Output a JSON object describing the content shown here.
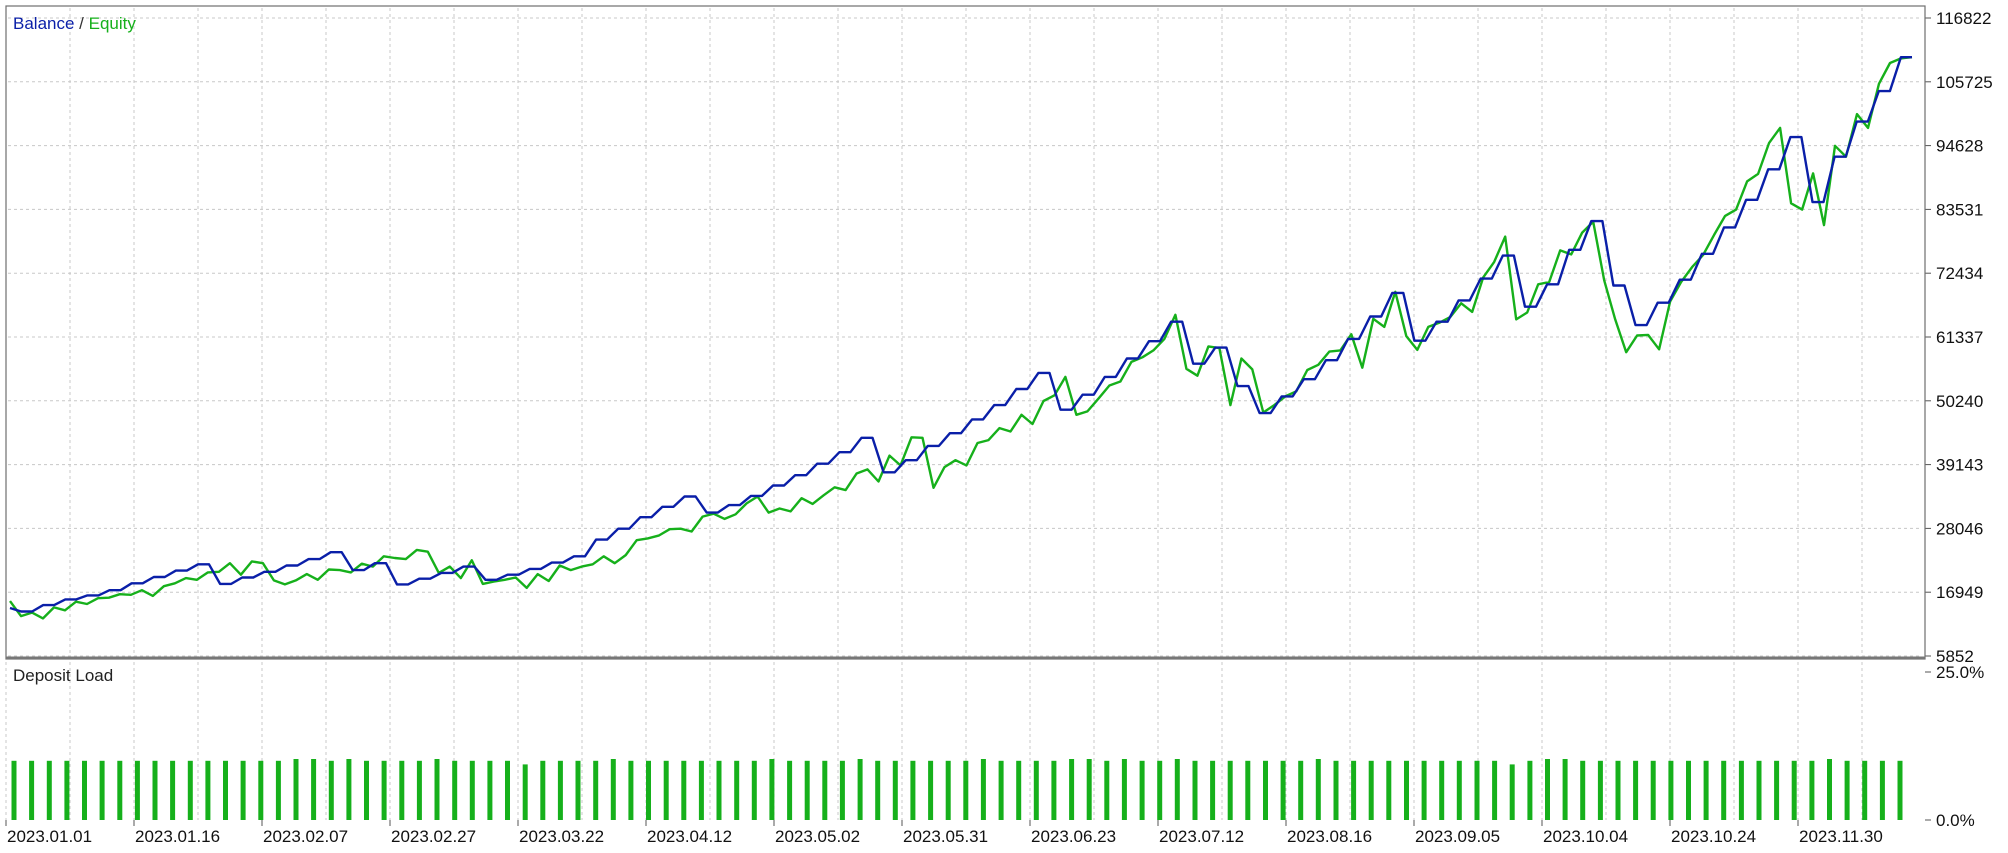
{
  "chart_data": [
    {
      "type": "line",
      "panel": "main",
      "legend": {
        "balance_label": "Balance",
        "separator": " / ",
        "equity_label": "Equity",
        "placement": "top-left"
      },
      "ylim": [
        5852,
        116822
      ],
      "y_ticks": [
        "116822",
        "105725",
        "94628",
        "83531",
        "72434",
        "61337",
        "50240",
        "39143",
        "28046",
        "16949",
        "5852"
      ],
      "grid": true,
      "colors": {
        "balance": "#0a1fa8",
        "equity": "#16b01b",
        "grid": "#c8c8c8",
        "axis": "#555555"
      },
      "series": [
        {
          "name": "Balance",
          "values": [
            14200,
            13600,
            13600,
            14700,
            14700,
            15700,
            15700,
            16400,
            16400,
            17300,
            17300,
            18500,
            18500,
            19600,
            19600,
            20700,
            20700,
            21800,
            21800,
            18400,
            18400,
            19500,
            19500,
            20500,
            20500,
            21600,
            21600,
            22700,
            22700,
            23900,
            23900,
            20800,
            20800,
            22000,
            22000,
            18300,
            18300,
            19300,
            19300,
            20300,
            20300,
            21400,
            21400,
            19100,
            19100,
            20000,
            20000,
            21000,
            21000,
            22100,
            22100,
            23200,
            23200,
            26100,
            26100,
            28000,
            28000,
            30000,
            30000,
            31800,
            31800,
            33600,
            33600,
            30800,
            30800,
            32100,
            32100,
            33700,
            33700,
            35500,
            35500,
            37300,
            37300,
            39300,
            39300,
            41300,
            41300,
            43800,
            43800,
            37800,
            37800,
            39900,
            39900,
            42400,
            42400,
            44600,
            44600,
            47000,
            47000,
            49500,
            49500,
            52300,
            52300,
            55100,
            55100,
            48700,
            48700,
            51300,
            51300,
            54400,
            54400,
            57600,
            57600,
            60600,
            60600,
            64000,
            64000,
            56700,
            56700,
            59500,
            59500,
            52800,
            52800,
            48100,
            48100,
            51000,
            51000,
            54000,
            54000,
            57300,
            57300,
            61000,
            61000,
            64900,
            64900,
            69000,
            69000,
            60700,
            60700,
            64000,
            64000,
            67700,
            67700,
            71500,
            71500,
            75500,
            75500,
            66600,
            66600,
            70500,
            70500,
            76500,
            76500,
            81500,
            81500,
            70300,
            70300,
            63400,
            63400,
            67300,
            67300,
            71300,
            71300,
            75800,
            75800,
            80400,
            80400,
            85200,
            85200,
            90500,
            90500,
            96100,
            96100,
            84800,
            84800,
            92700,
            92700,
            98800,
            98800,
            104100,
            104100,
            110000,
            110000
          ]
        },
        {
          "name": "Equity",
          "values": [
            15400,
            12800,
            13400,
            12400,
            14300,
            13800,
            15300,
            14900,
            15900,
            16000,
            16600,
            16500,
            17300,
            16300,
            18000,
            18500,
            19400,
            19100,
            20400,
            20500,
            22000,
            20000,
            22300,
            22000,
            19000,
            18300,
            19000,
            20100,
            19100,
            20900,
            20800,
            20400,
            21900,
            21400,
            23200,
            22900,
            22700,
            24300,
            24000,
            20300,
            21400,
            19400,
            22500,
            18400,
            18800,
            19100,
            19500,
            17700,
            20100,
            18900,
            21600,
            20800,
            21400,
            21800,
            23200,
            22000,
            23400,
            26000,
            26300,
            26800,
            27900,
            28000,
            27500,
            30100,
            30600,
            29700,
            30500,
            32400,
            33600,
            30800,
            31500,
            31000,
            33300,
            32300,
            33800,
            35200,
            34700,
            37600,
            38300,
            36200,
            40700,
            39000,
            43900,
            43800,
            35100,
            38700,
            39900,
            39000,
            42900,
            43400,
            45500,
            44900,
            47800,
            46200,
            50200,
            51200,
            54400,
            47800,
            48400,
            50600,
            52900,
            53600,
            57000,
            57800,
            59000,
            61000,
            65200,
            55800,
            54600,
            59700,
            59400,
            49500,
            57600,
            55700,
            48200,
            49500,
            51000,
            51900,
            55600,
            56500,
            58800,
            59000,
            61800,
            56000,
            64500,
            63100,
            69200,
            61500,
            59100,
            63100,
            63800,
            64800,
            67200,
            65700,
            71700,
            74400,
            78800,
            64400,
            65600,
            70500,
            70900,
            76400,
            75700,
            79500,
            81400,
            71200,
            64400,
            58700,
            61600,
            61700,
            59200,
            67500,
            70900,
            73500,
            75600,
            79100,
            82400,
            83500,
            88400,
            89700,
            95100,
            97700,
            84600,
            83500,
            89800,
            80800,
            94600,
            92700,
            100100,
            97700,
            105400,
            109000,
            109800,
            110000
          ]
        }
      ]
    },
    {
      "type": "bar",
      "panel": "deposit-load",
      "title": "Deposit Load",
      "ylim": [
        0,
        25
      ],
      "y_ticks": [
        "25.0%",
        "0.0%"
      ],
      "x_ticks": [
        "2023.01.01",
        "2023.01.16",
        "2023.02.07",
        "2023.02.27",
        "2023.03.22",
        "2023.04.12",
        "2023.05.02",
        "2023.05.31",
        "2023.06.23",
        "2023.07.12",
        "2023.08.16",
        "2023.09.05",
        "2023.10.04",
        "2023.10.24",
        "2023.11.30"
      ],
      "colors": {
        "bar": "#16b01b"
      },
      "values": [
        10.0,
        10.0,
        10.0,
        10.0,
        10.0,
        10.0,
        10.0,
        10.0,
        10.0,
        10.0,
        10.0,
        10.0,
        10.0,
        10.0,
        10.0,
        10.0,
        10.3,
        10.3,
        10.0,
        10.3,
        10.0,
        10.0,
        10.0,
        10.0,
        10.3,
        10.0,
        10.0,
        10.0,
        10.0,
        9.4,
        10.0,
        10.0,
        10.0,
        10.0,
        10.3,
        10.0,
        10.0,
        10.0,
        10.0,
        10.0,
        10.0,
        10.0,
        10.0,
        10.3,
        10.0,
        10.0,
        10.0,
        10.0,
        10.3,
        10.0,
        10.0,
        10.0,
        10.0,
        10.0,
        10.0,
        10.3,
        10.0,
        10.0,
        10.0,
        10.0,
        10.3,
        10.3,
        10.0,
        10.3,
        10.0,
        10.0,
        10.3,
        10.0,
        10.0,
        10.0,
        10.0,
        10.0,
        10.0,
        10.0,
        10.3,
        10.0,
        10.0,
        10.0,
        10.0,
        10.0,
        10.0,
        10.0,
        10.0,
        10.0,
        10.0,
        9.4,
        10.0,
        10.3,
        10.3,
        10.0,
        10.0,
        10.0,
        10.0,
        10.0,
        10.0,
        10.0,
        10.0,
        10.0,
        10.0,
        10.0,
        10.0,
        10.0,
        10.0,
        10.3,
        10.0,
        10.0,
        10.0,
        10.0
      ]
    }
  ]
}
